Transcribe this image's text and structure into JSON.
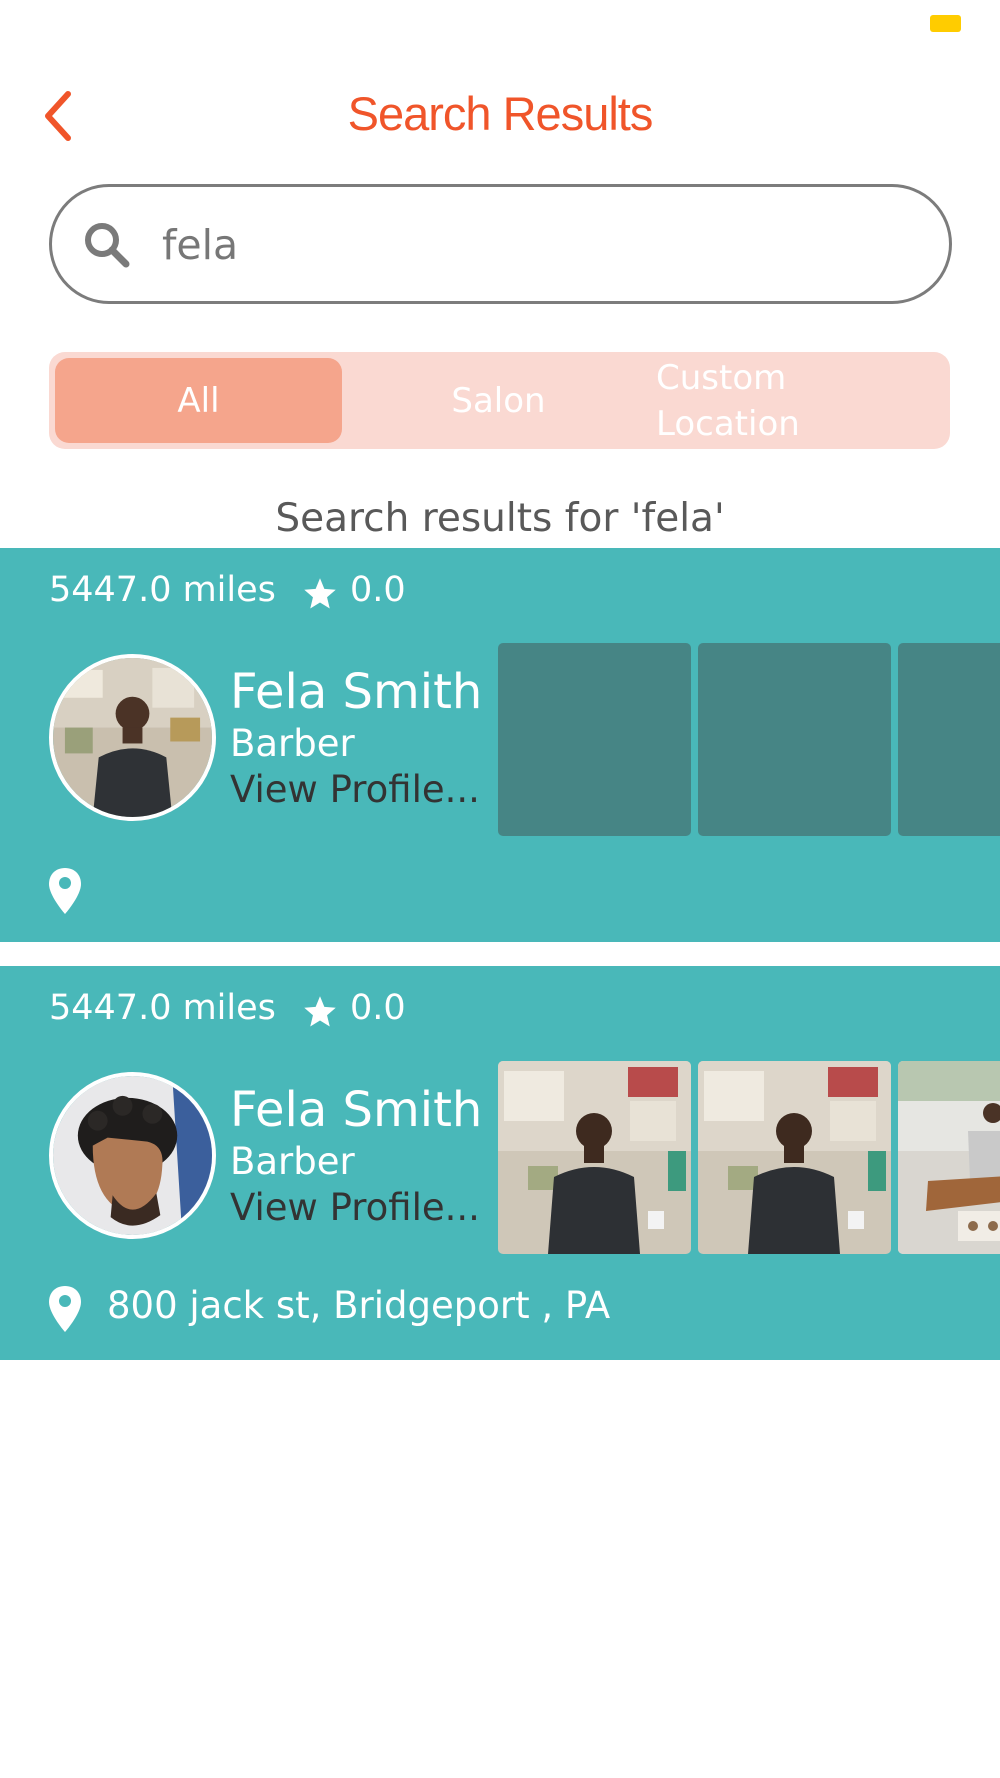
{
  "theme": {
    "accent": "#F0552A",
    "card_bg": "#49B8B9",
    "card_placeholder": "#468585",
    "segment_track": "#FAD9D2",
    "segment_selected": "#F5A58C",
    "battery": "#FFCC00"
  },
  "header": {
    "title": "Search Results",
    "back_icon": "chevron-left-icon"
  },
  "search": {
    "value": "fela",
    "icon": "search-icon"
  },
  "filters": {
    "tabs": [
      {
        "label": "All",
        "selected": true
      },
      {
        "label": "Salon",
        "selected": false
      },
      {
        "label": "Custom Location",
        "selected": false
      }
    ]
  },
  "results": {
    "caption": "Search results for 'fela'",
    "items": [
      {
        "distance": "5447.0 miles",
        "rating": "0.0",
        "name": "Fela Smith",
        "role": "Barber",
        "link": "View Profile...",
        "address": "",
        "photos_loaded": false
      },
      {
        "distance": "5447.0 miles",
        "rating": "0.0",
        "name": "Fela Smith",
        "role": "Barber",
        "link": "View Profile...",
        "address": "800 jack st, Bridgeport , PA",
        "photos_loaded": true
      }
    ]
  }
}
